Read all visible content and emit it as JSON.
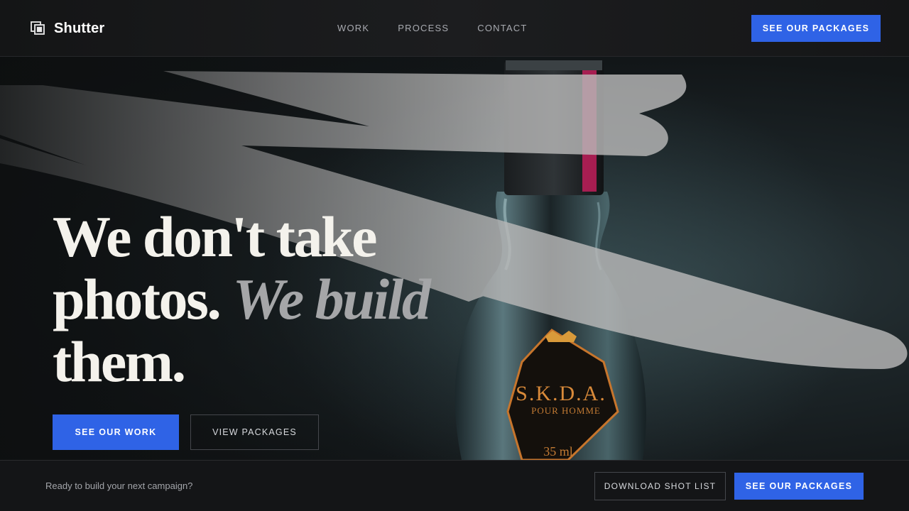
{
  "brand": {
    "name": "Shutter",
    "logo_icon": "stacked-frames-icon"
  },
  "nav": {
    "items": [
      "WORK",
      "PROCESS",
      "CONTACT"
    ]
  },
  "header": {
    "cta_label": "SEE OUR PACKAGES"
  },
  "hero": {
    "title_line1": "We don't take",
    "title_line2a": "photos.",
    "title_line2b": "We build",
    "title_line3": "them.",
    "primary_cta": "SEE OUR WORK",
    "secondary_cta": "VIEW PACKAGES",
    "image": {
      "subject": "perfume bottle",
      "label_main": "S.K.D.A.",
      "label_sub": "POUR HOMME",
      "label_volume": "35 ml"
    }
  },
  "footer": {
    "prompt": "Ready to build your next campaign?",
    "download_label": "DOWNLOAD SHOT LIST",
    "cta_label": "SEE OUR PACKAGES"
  },
  "colors": {
    "accent": "#2f63e6",
    "background": "#111214",
    "title": "#f4f2ec",
    "title_accent": "#a5a6a8"
  }
}
